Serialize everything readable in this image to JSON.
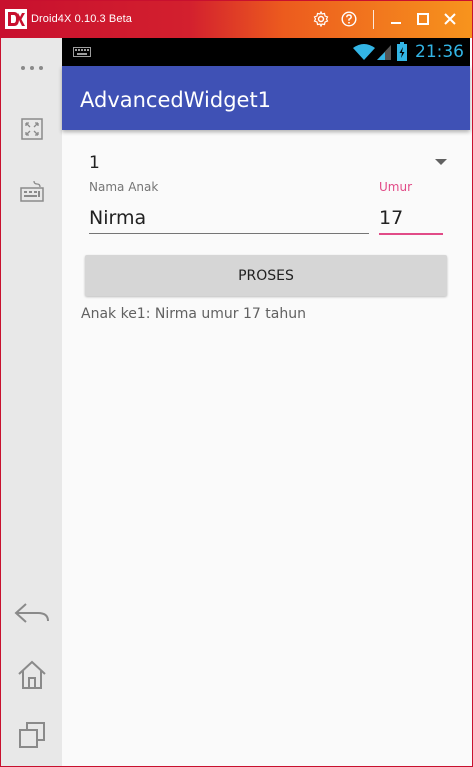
{
  "window": {
    "title": "Droid4X 0.10.3 Beta",
    "accent_color": "#c8102e"
  },
  "titlebar_icons": [
    "gear-icon",
    "help-icon",
    "minimize-icon",
    "maximize-icon",
    "close-icon"
  ],
  "sidebar": {
    "items": [
      "more-icon",
      "fullscreen-icon",
      "keyboard-icon",
      "back-icon",
      "home-icon",
      "recent-apps-icon"
    ]
  },
  "statusbar": {
    "time": "21:36",
    "time_color": "#33b5e5"
  },
  "appbar": {
    "title": "AdvancedWidget1",
    "color": "#3f51b5"
  },
  "form": {
    "spinner_value": "1",
    "name_label": "Nama Anak",
    "name_value": "Nirma",
    "age_label": "Umur",
    "age_value": "17",
    "focus_color": "#e14b87",
    "button_label": "PROSES",
    "result_text": "Anak ke1: Nirma umur 17 tahun"
  }
}
